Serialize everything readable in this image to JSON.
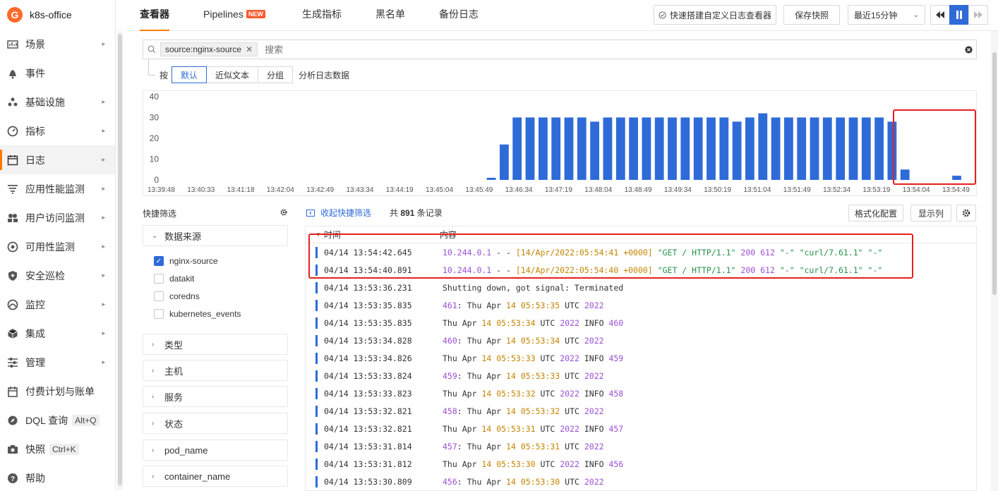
{
  "brand": {
    "name": "k8s-office",
    "logo_text": "G"
  },
  "sidebar": {
    "items": [
      {
        "label": "场景",
        "icon": "dashboard-icon",
        "arrow": true
      },
      {
        "label": "事件",
        "icon": "bell-icon",
        "arrow": false
      },
      {
        "label": "基础设施",
        "icon": "cluster-icon",
        "arrow": true
      },
      {
        "label": "指标",
        "icon": "gauge-icon",
        "arrow": true
      },
      {
        "label": "日志",
        "icon": "calendar-log-icon",
        "arrow": true,
        "active": true
      },
      {
        "label": "应用性能监测",
        "icon": "apm-icon",
        "arrow": true
      },
      {
        "label": "用户访问监测",
        "icon": "users-icon",
        "arrow": true
      },
      {
        "label": "可用性监测",
        "icon": "globe-icon",
        "arrow": true
      },
      {
        "label": "安全巡检",
        "icon": "shield-icon",
        "arrow": true
      },
      {
        "label": "监控",
        "icon": "monitor-icon",
        "arrow": true
      },
      {
        "label": "集成",
        "icon": "cube-icon",
        "arrow": true
      },
      {
        "label": "管理",
        "icon": "sliders-icon",
        "arrow": true
      },
      {
        "label": "付费计划与账单",
        "icon": "billing-icon",
        "arrow": false
      },
      {
        "label": "DQL 查询",
        "icon": "compass-icon",
        "arrow": false,
        "shortcut": "Alt+Q"
      },
      {
        "label": "快照",
        "icon": "camera-icon",
        "arrow": false,
        "shortcut": "Ctrl+K"
      },
      {
        "label": "帮助",
        "icon": "help-icon",
        "arrow": false
      }
    ]
  },
  "topbar": {
    "tabs": [
      {
        "label": "查看器",
        "active": true
      },
      {
        "label": "Pipelines",
        "badge": "NEW"
      },
      {
        "label": "生成指标"
      },
      {
        "label": "黑名单"
      },
      {
        "label": "备份日志"
      }
    ],
    "quick_build": "快速搭建自定义日志查看器",
    "save_snapshot": "保存快照",
    "time_range": "最近15分钟"
  },
  "search": {
    "tag": "source:nginx-source",
    "placeholder": "搜索"
  },
  "grouping": {
    "prefix": "按",
    "options": [
      "默认",
      "近似文本",
      "分组"
    ],
    "selected": "默认",
    "suffix": "分析日志数据"
  },
  "chart_data": {
    "type": "bar",
    "ylim": [
      0,
      40
    ],
    "yticks": [
      0,
      10,
      20,
      30,
      40
    ],
    "xticks": [
      "13:39:48",
      "13:40:33",
      "13:41:18",
      "13:42:04",
      "13:42:49",
      "13:43:34",
      "13:44:19",
      "13:45:04",
      "13:45:49",
      "13:46:34",
      "13:47:19",
      "13:48:04",
      "13:48:49",
      "13:49:34",
      "13:50:19",
      "13:51:04",
      "13:51:49",
      "13:52:34",
      "13:53:19",
      "13:54:04",
      "13:54:49"
    ],
    "values": [
      0,
      0,
      0,
      0,
      0,
      0,
      0,
      0,
      0,
      0,
      0,
      0,
      0,
      0,
      0,
      0,
      0,
      0,
      0,
      0,
      0,
      0,
      0,
      0,
      0,
      1,
      17,
      30,
      30,
      30,
      30,
      30,
      30,
      28,
      30,
      30,
      30,
      30,
      30,
      30,
      30,
      30,
      30,
      30,
      28,
      30,
      32,
      30,
      30,
      30,
      30,
      30,
      30,
      30,
      30,
      30,
      28,
      5,
      0,
      0,
      0,
      2,
      0
    ],
    "color": "#2f6bd8"
  },
  "quick_filter": {
    "title": "快捷筛选",
    "sections": [
      {
        "label": "数据来源",
        "expanded": true,
        "options": [
          {
            "label": "nginx-source",
            "checked": true
          },
          {
            "label": "datakit",
            "checked": false
          },
          {
            "label": "coredns",
            "checked": false
          },
          {
            "label": "kubernetes_events",
            "checked": false
          }
        ]
      },
      {
        "label": "类型",
        "expanded": false
      },
      {
        "label": "主机",
        "expanded": false
      },
      {
        "label": "服务",
        "expanded": false
      },
      {
        "label": "状态",
        "expanded": false
      },
      {
        "label": "pod_name",
        "expanded": false
      },
      {
        "label": "container_name",
        "expanded": false
      }
    ]
  },
  "list": {
    "collapse_link": "收起快捷筛选",
    "count_prefix": "共",
    "count": "891",
    "count_suffix": "条记录",
    "format_btn": "格式化配置",
    "columns_btn": "显示列",
    "col_time": "时间",
    "col_content": "内容",
    "rows": [
      {
        "time": "04/14 13:54:42.645",
        "tokens": [
          [
            "ip",
            "10.244.0.1"
          ],
          [
            "p",
            " - - "
          ],
          [
            "ts",
            "[14/Apr/2022:05:54:41 +0000]"
          ],
          [
            "p",
            " "
          ],
          [
            "str",
            "\"GET / HTTP/1.1\""
          ],
          [
            "p",
            " "
          ],
          [
            "num",
            "200"
          ],
          [
            "p",
            " "
          ],
          [
            "num",
            "612"
          ],
          [
            "p",
            " "
          ],
          [
            "str",
            "\"-\""
          ],
          [
            "p",
            " "
          ],
          [
            "str",
            "\"curl/7.61.1\""
          ],
          [
            "p",
            " "
          ],
          [
            "str",
            "\"-\""
          ]
        ]
      },
      {
        "time": "04/14 13:54:40.891",
        "tokens": [
          [
            "ip",
            "10.244.0.1"
          ],
          [
            "p",
            " - - "
          ],
          [
            "ts",
            "[14/Apr/2022:05:54:40 +0000]"
          ],
          [
            "p",
            " "
          ],
          [
            "str",
            "\"GET / HTTP/1.1\""
          ],
          [
            "p",
            " "
          ],
          [
            "num",
            "200"
          ],
          [
            "p",
            " "
          ],
          [
            "num",
            "612"
          ],
          [
            "p",
            " "
          ],
          [
            "str",
            "\"-\""
          ],
          [
            "p",
            " "
          ],
          [
            "str",
            "\"curl/7.61.1\""
          ],
          [
            "p",
            " "
          ],
          [
            "str",
            "\"-\""
          ]
        ]
      },
      {
        "time": "04/14 13:53:36.231",
        "tokens": [
          [
            "p",
            "Shutting down, got signal: Terminated"
          ]
        ]
      },
      {
        "time": "04/14 13:53:35.835",
        "tokens": [
          [
            "num",
            "461"
          ],
          [
            "p",
            ": Thu Apr "
          ],
          [
            "ts",
            "14"
          ],
          [
            "p",
            " "
          ],
          [
            "ts",
            "05:53:35"
          ],
          [
            "p",
            " UTC "
          ],
          [
            "num",
            "2022"
          ]
        ]
      },
      {
        "time": "04/14 13:53:35.835",
        "tokens": [
          [
            "p",
            "Thu Apr "
          ],
          [
            "ts",
            "14"
          ],
          [
            "p",
            " "
          ],
          [
            "ts",
            "05:53:34"
          ],
          [
            "p",
            " UTC "
          ],
          [
            "num",
            "2022"
          ],
          [
            "p",
            " INFO "
          ],
          [
            "num",
            "460"
          ]
        ]
      },
      {
        "time": "04/14 13:53:34.828",
        "tokens": [
          [
            "num",
            "460"
          ],
          [
            "p",
            ": Thu Apr "
          ],
          [
            "ts",
            "14"
          ],
          [
            "p",
            " "
          ],
          [
            "ts",
            "05:53:34"
          ],
          [
            "p",
            " UTC "
          ],
          [
            "num",
            "2022"
          ]
        ]
      },
      {
        "time": "04/14 13:53:34.826",
        "tokens": [
          [
            "p",
            "Thu Apr "
          ],
          [
            "ts",
            "14"
          ],
          [
            "p",
            " "
          ],
          [
            "ts",
            "05:53:33"
          ],
          [
            "p",
            " UTC "
          ],
          [
            "num",
            "2022"
          ],
          [
            "p",
            " INFO "
          ],
          [
            "num",
            "459"
          ]
        ]
      },
      {
        "time": "04/14 13:53:33.824",
        "tokens": [
          [
            "num",
            "459"
          ],
          [
            "p",
            ": Thu Apr "
          ],
          [
            "ts",
            "14"
          ],
          [
            "p",
            " "
          ],
          [
            "ts",
            "05:53:33"
          ],
          [
            "p",
            " UTC "
          ],
          [
            "num",
            "2022"
          ]
        ]
      },
      {
        "time": "04/14 13:53:33.823",
        "tokens": [
          [
            "p",
            "Thu Apr "
          ],
          [
            "ts",
            "14"
          ],
          [
            "p",
            " "
          ],
          [
            "ts",
            "05:53:32"
          ],
          [
            "p",
            " UTC "
          ],
          [
            "num",
            "2022"
          ],
          [
            "p",
            " INFO "
          ],
          [
            "num",
            "458"
          ]
        ]
      },
      {
        "time": "04/14 13:53:32.821",
        "tokens": [
          [
            "num",
            "458"
          ],
          [
            "p",
            ": Thu Apr "
          ],
          [
            "ts",
            "14"
          ],
          [
            "p",
            " "
          ],
          [
            "ts",
            "05:53:32"
          ],
          [
            "p",
            " UTC "
          ],
          [
            "num",
            "2022"
          ]
        ]
      },
      {
        "time": "04/14 13:53:32.821",
        "tokens": [
          [
            "p",
            "Thu Apr "
          ],
          [
            "ts",
            "14"
          ],
          [
            "p",
            " "
          ],
          [
            "ts",
            "05:53:31"
          ],
          [
            "p",
            " UTC "
          ],
          [
            "num",
            "2022"
          ],
          [
            "p",
            " INFO "
          ],
          [
            "num",
            "457"
          ]
        ]
      },
      {
        "time": "04/14 13:53:31.814",
        "tokens": [
          [
            "num",
            "457"
          ],
          [
            "p",
            ": Thu Apr "
          ],
          [
            "ts",
            "14"
          ],
          [
            "p",
            " "
          ],
          [
            "ts",
            "05:53:31"
          ],
          [
            "p",
            " UTC "
          ],
          [
            "num",
            "2022"
          ]
        ]
      },
      {
        "time": "04/14 13:53:31.812",
        "tokens": [
          [
            "p",
            "Thu Apr "
          ],
          [
            "ts",
            "14"
          ],
          [
            "p",
            " "
          ],
          [
            "ts",
            "05:53:30"
          ],
          [
            "p",
            " UTC "
          ],
          [
            "num",
            "2022"
          ],
          [
            "p",
            " INFO "
          ],
          [
            "num",
            "456"
          ]
        ]
      },
      {
        "time": "04/14 13:53:30.809",
        "tokens": [
          [
            "num",
            "456"
          ],
          [
            "p",
            ": Thu Apr "
          ],
          [
            "ts",
            "14"
          ],
          [
            "p",
            " "
          ],
          [
            "ts",
            "05:53:30"
          ],
          [
            "p",
            " UTC "
          ],
          [
            "num",
            "2022"
          ]
        ]
      }
    ]
  },
  "colors": {
    "accent": "#ff7a00",
    "primary": "#2f6bd8",
    "highlight": "#e81e1e"
  }
}
